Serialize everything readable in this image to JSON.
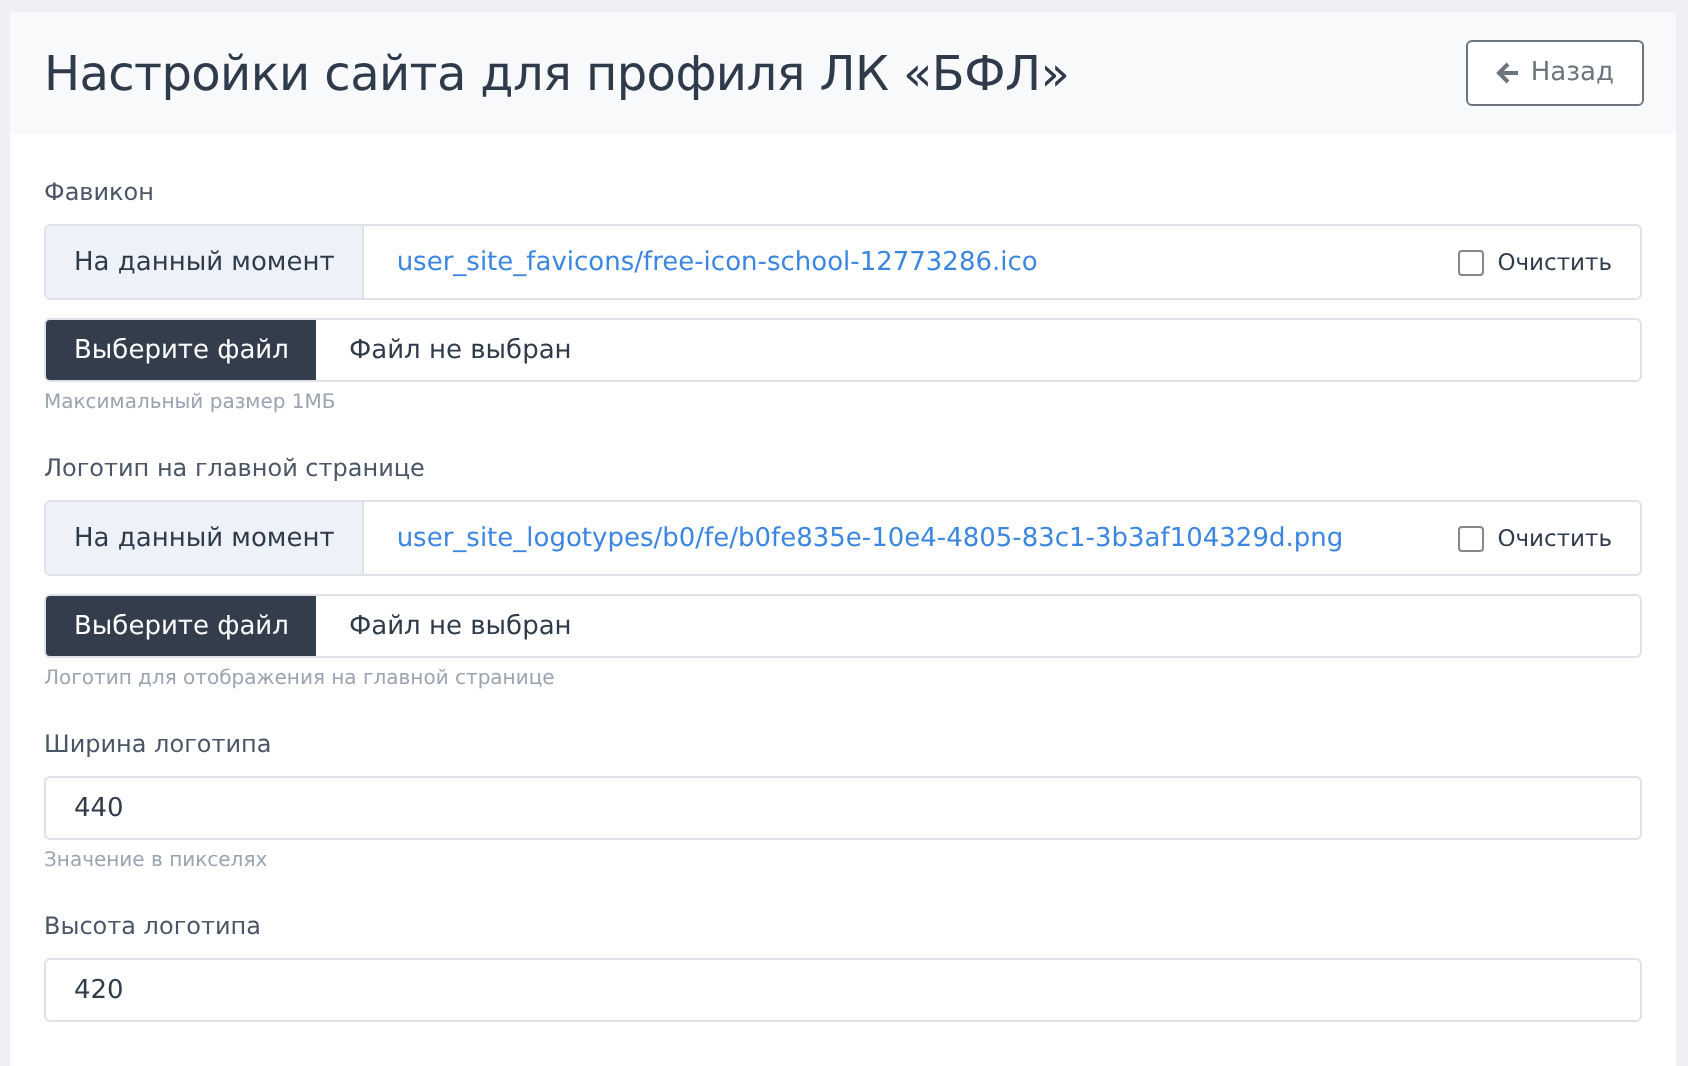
{
  "header": {
    "title": "Настройки сайта для профиля ЛК «БФЛ»",
    "back_button": "Назад"
  },
  "fields": [
    {
      "kind": "file",
      "label": "Фавикон",
      "current_label": "На данный момент",
      "current_value": "user_site_favicons/free-icon-school-12773286.ico",
      "clear_label": "Очистить",
      "clear_checked": false,
      "choose_label": "Выберите файл",
      "file_status": "Файл не выбран",
      "help": "Максимальный размер 1МБ"
    },
    {
      "kind": "file",
      "label": "Логотип на главной странице",
      "current_label": "На данный момент",
      "current_value": "user_site_logotypes/b0/fe/b0fe835e-10e4-4805-83c1-3b3af104329d.png",
      "clear_label": "Очистить",
      "clear_checked": false,
      "choose_label": "Выберите файл",
      "file_status": "Файл не выбран",
      "help": "Логотип для отображения на главной странице"
    },
    {
      "kind": "number",
      "label": "Ширина логотипа",
      "value": "440",
      "help": "Значение в пикселях"
    },
    {
      "kind": "number",
      "label": "Высота логотипа",
      "value": "420"
    }
  ]
}
